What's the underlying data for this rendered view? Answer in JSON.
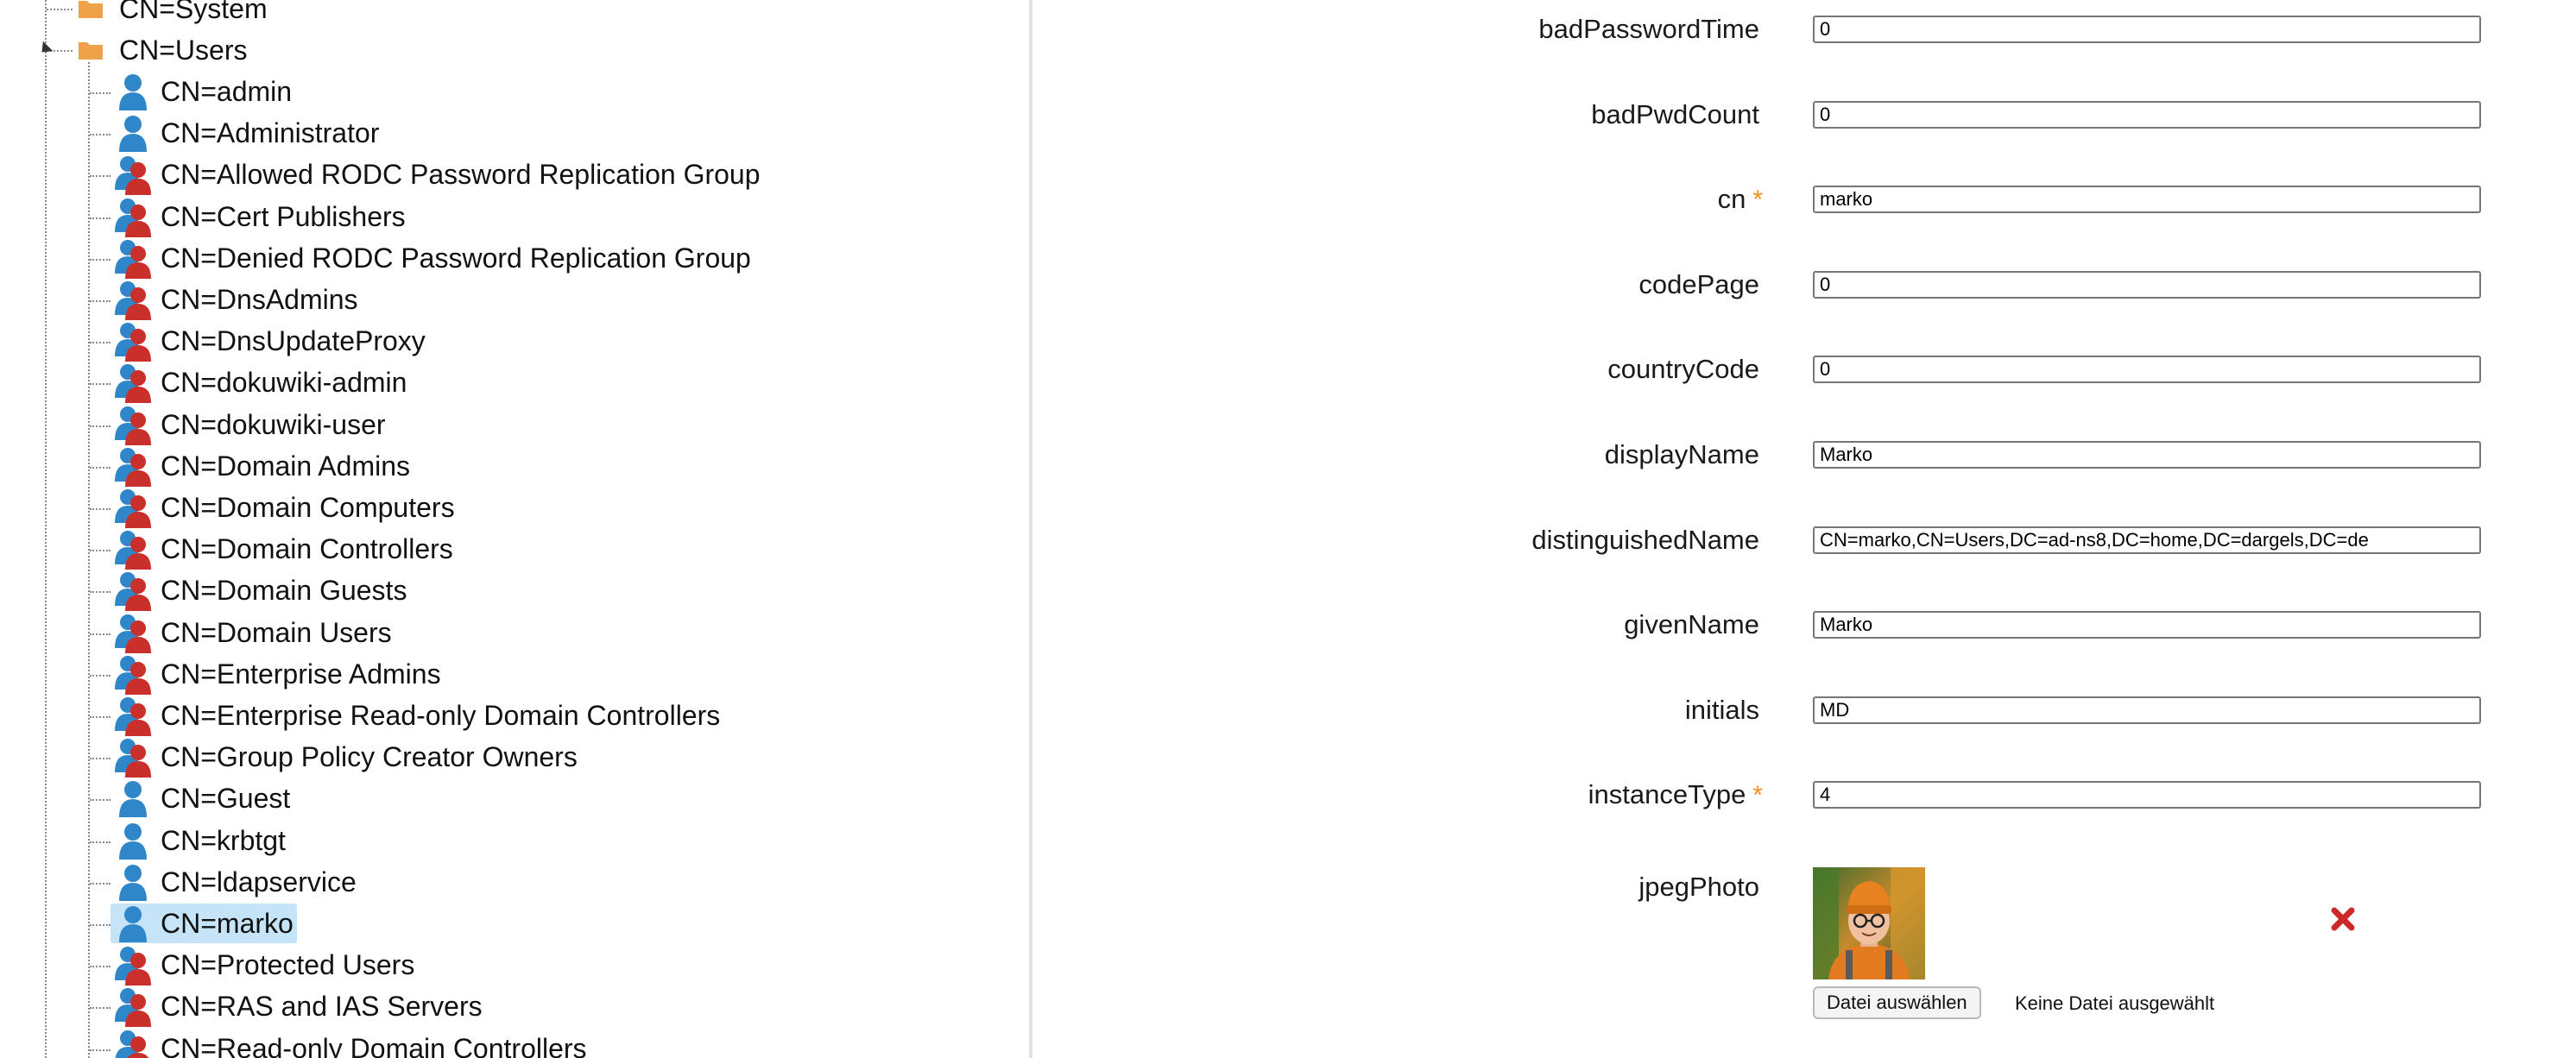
{
  "tree": {
    "containers": [
      {
        "label": "CN=System",
        "state": "collapsed"
      },
      {
        "label": "CN=Users",
        "state": "expanded"
      }
    ],
    "items": [
      {
        "label": "CN=admin",
        "type": "user"
      },
      {
        "label": "CN=Administrator",
        "type": "user"
      },
      {
        "label": "CN=Allowed RODC Password Replication Group",
        "type": "group"
      },
      {
        "label": "CN=Cert Publishers",
        "type": "group"
      },
      {
        "label": "CN=Denied RODC Password Replication Group",
        "type": "group"
      },
      {
        "label": "CN=DnsAdmins",
        "type": "group"
      },
      {
        "label": "CN=DnsUpdateProxy",
        "type": "group"
      },
      {
        "label": "CN=dokuwiki-admin",
        "type": "group"
      },
      {
        "label": "CN=dokuwiki-user",
        "type": "group"
      },
      {
        "label": "CN=Domain Admins",
        "type": "group"
      },
      {
        "label": "CN=Domain Computers",
        "type": "group"
      },
      {
        "label": "CN=Domain Controllers",
        "type": "group"
      },
      {
        "label": "CN=Domain Guests",
        "type": "group"
      },
      {
        "label": "CN=Domain Users",
        "type": "group"
      },
      {
        "label": "CN=Enterprise Admins",
        "type": "group"
      },
      {
        "label": "CN=Enterprise Read-only Domain Controllers",
        "type": "group"
      },
      {
        "label": "CN=Group Policy Creator Owners",
        "type": "group"
      },
      {
        "label": "CN=Guest",
        "type": "user"
      },
      {
        "label": "CN=krbtgt",
        "type": "user"
      },
      {
        "label": "CN=ldapservice",
        "type": "user"
      },
      {
        "label": "CN=marko",
        "type": "user",
        "selected": true
      },
      {
        "label": "CN=Protected Users",
        "type": "group"
      },
      {
        "label": "CN=RAS and IAS Servers",
        "type": "group"
      },
      {
        "label": "CN=Read-only Domain Controllers",
        "type": "group"
      }
    ]
  },
  "form": {
    "fields": [
      {
        "name": "badPasswordTime",
        "value": "0",
        "required": false
      },
      {
        "name": "badPwdCount",
        "value": "0",
        "required": false
      },
      {
        "name": "cn",
        "value": "marko",
        "required": true
      },
      {
        "name": "codePage",
        "value": "0",
        "required": false
      },
      {
        "name": "countryCode",
        "value": "0",
        "required": false
      },
      {
        "name": "displayName",
        "value": "Marko",
        "required": false
      },
      {
        "name": "distinguishedName",
        "value": "CN=marko,CN=Users,DC=ad-ns8,DC=home,DC=dargels,DC=de",
        "required": false
      },
      {
        "name": "givenName",
        "value": "Marko",
        "required": false
      },
      {
        "name": "initials",
        "value": "MD",
        "required": false
      },
      {
        "name": "instanceType",
        "value": "4",
        "required": true
      }
    ],
    "required_marker": "*",
    "photo": {
      "label": "jpegPhoto",
      "choose_button": "Datei auswählen",
      "no_file_text": "Keine Datei ausgewählt",
      "delete_icon": "red-x-delete-icon"
    }
  },
  "colors": {
    "user_icon": "#2f86c8",
    "group_front": "#c9302c",
    "folder": "#f0a24a",
    "selection": "#c6e4f7",
    "required": "#f0901c",
    "delete": "#cc2a2a"
  }
}
